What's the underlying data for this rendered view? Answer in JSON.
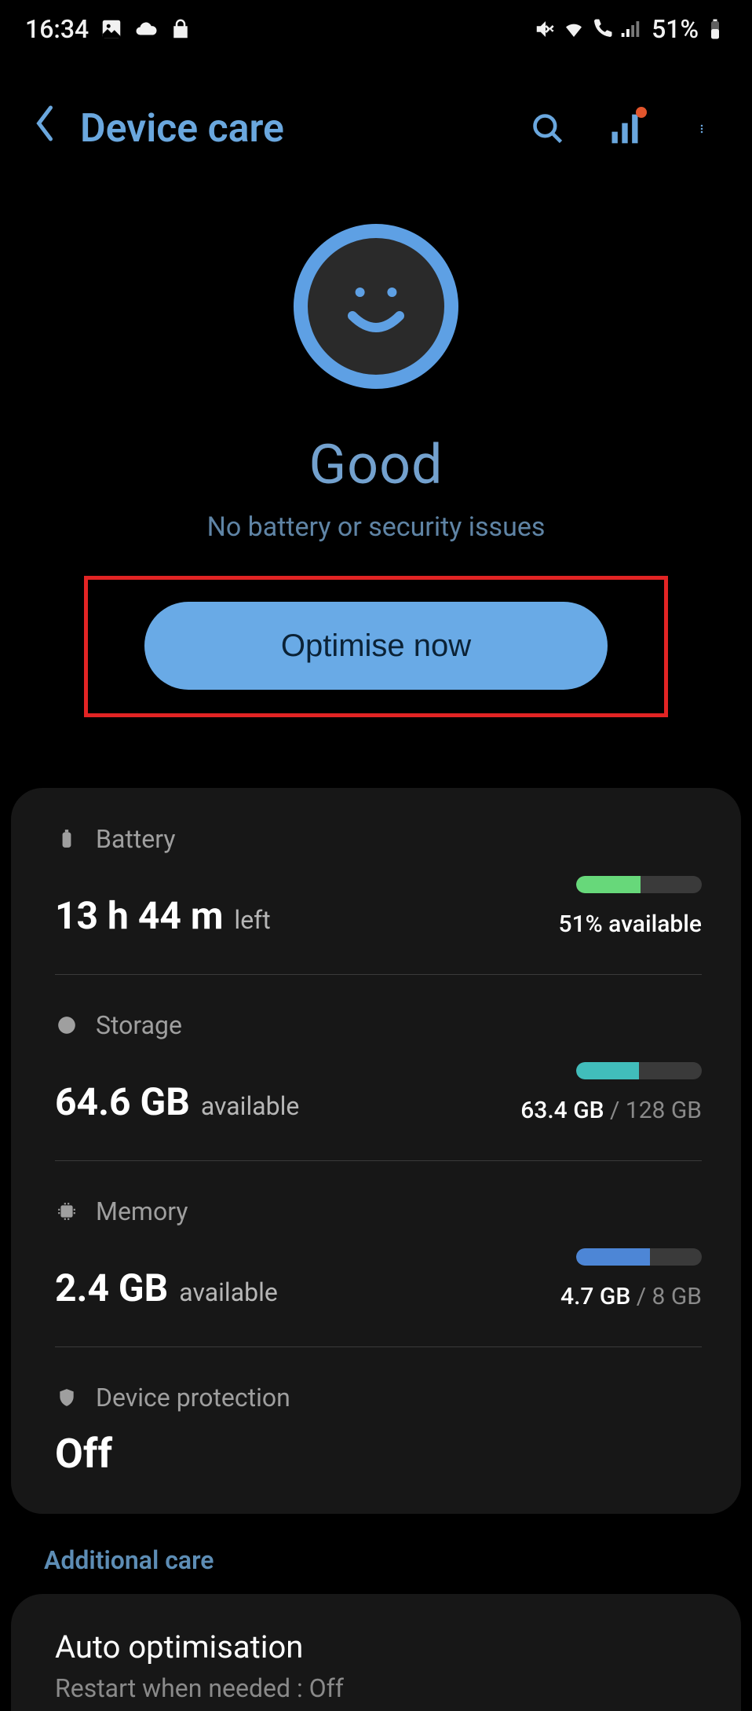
{
  "status_bar": {
    "time": "16:34",
    "battery_text": "51%"
  },
  "header": {
    "title": "Device care"
  },
  "hero": {
    "status": "Good",
    "subtitle": "No battery or security issues",
    "button_label": "Optimise now"
  },
  "items": {
    "battery": {
      "label": "Battery",
      "value": "13 h 44 m",
      "suffix": "left",
      "right": "51% available",
      "fill_pct": 51,
      "fill_color": "green"
    },
    "storage": {
      "label": "Storage",
      "value": "64.6 GB",
      "suffix": "available",
      "right_used": "63.4 GB",
      "right_total": " / 128 GB",
      "fill_pct": 50,
      "fill_color": "teal"
    },
    "memory": {
      "label": "Memory",
      "value": "2.4 GB",
      "suffix": "available",
      "right_used": "4.7 GB",
      "right_total": " / 8 GB",
      "fill_pct": 59,
      "fill_color": "blue"
    },
    "protection": {
      "label": "Device protection",
      "value": "Off"
    }
  },
  "additional": {
    "header": "Additional care",
    "auto_opt": {
      "title": "Auto optimisation",
      "subtitle": "Restart when needed : Off"
    }
  }
}
